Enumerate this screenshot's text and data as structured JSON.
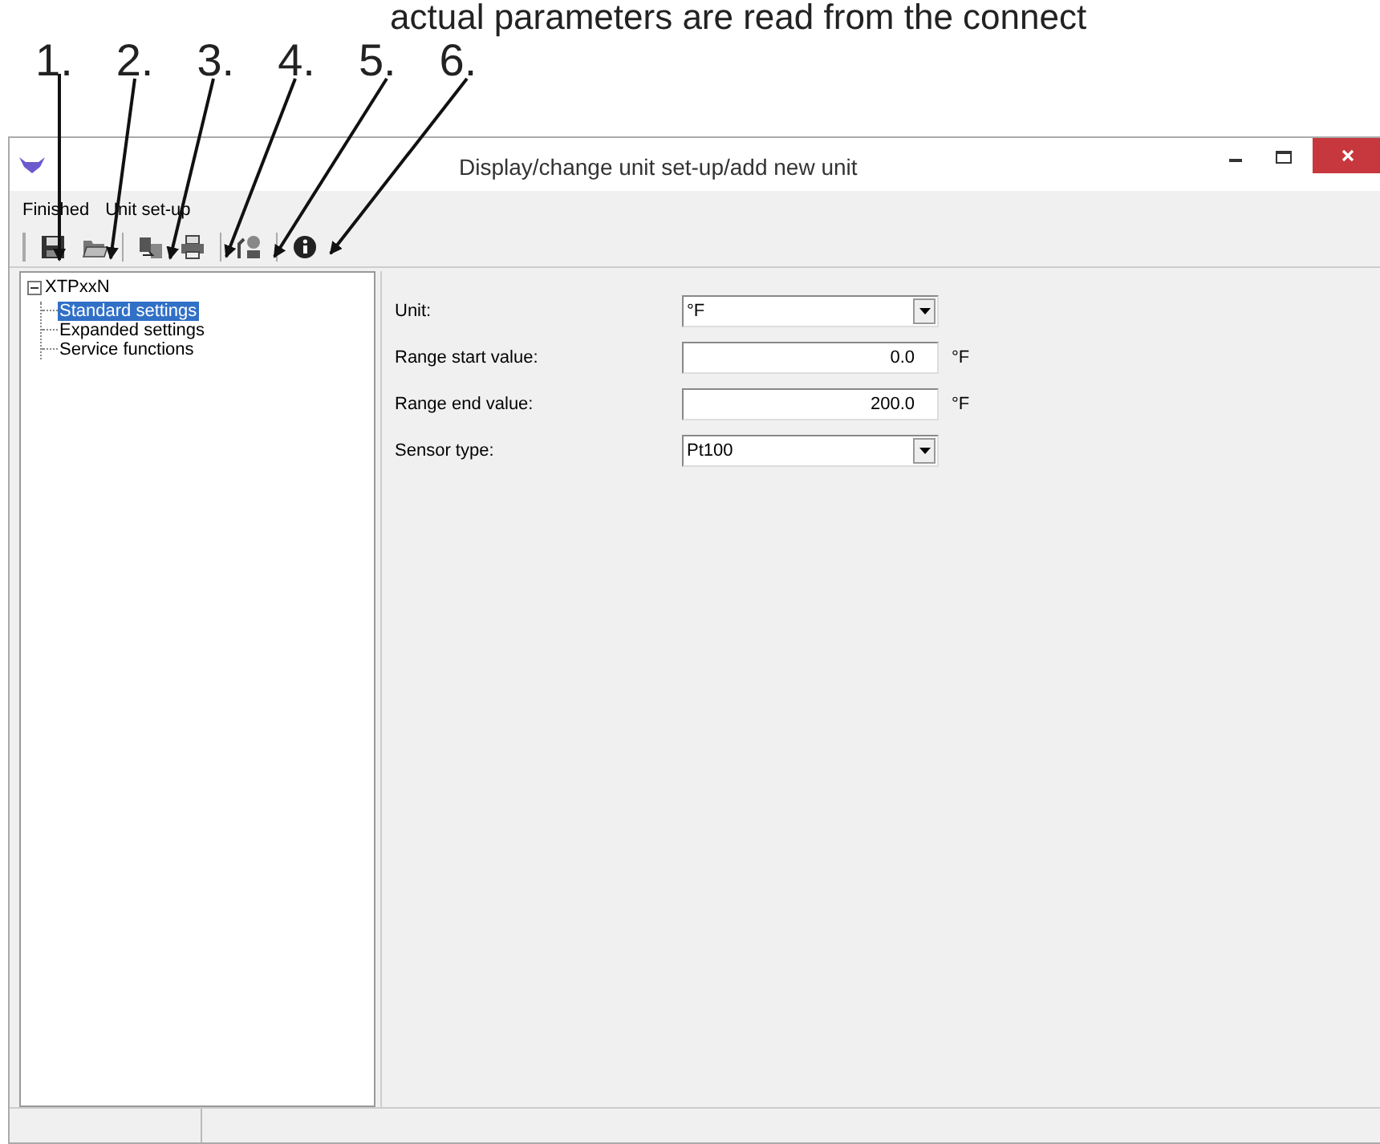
{
  "caption": "actual parameters are read from the connect",
  "callouts": [
    "1.",
    "2.",
    "3.",
    "4.",
    "5.",
    "6."
  ],
  "window": {
    "title": "Display/change unit set-up/add new unit"
  },
  "menu": [
    "Finished",
    "Unit set-up"
  ],
  "toolbar": [
    {
      "kind": "save"
    },
    {
      "kind": "open"
    },
    {
      "kind": "transfer"
    },
    {
      "kind": "print"
    },
    {
      "kind": "device"
    },
    {
      "kind": "info"
    }
  ],
  "tree": {
    "label": "XTPxxN",
    "expanded": true,
    "children": [
      {
        "label": "Standard settings",
        "selected": true
      },
      {
        "label": "Expanded settings",
        "selected": false
      },
      {
        "label": "Service functions",
        "selected": false
      }
    ]
  },
  "form": [
    {
      "label": "Unit:",
      "kind": "dropdown",
      "value": "°F"
    },
    {
      "label": "Range start value:",
      "kind": "number",
      "value": "0.0",
      "unit": "°F"
    },
    {
      "label": "Range end value:",
      "kind": "number",
      "value": "200.0",
      "unit": "°F"
    },
    {
      "label": "Sensor type:",
      "kind": "dropdown",
      "value": "Pt100"
    }
  ]
}
